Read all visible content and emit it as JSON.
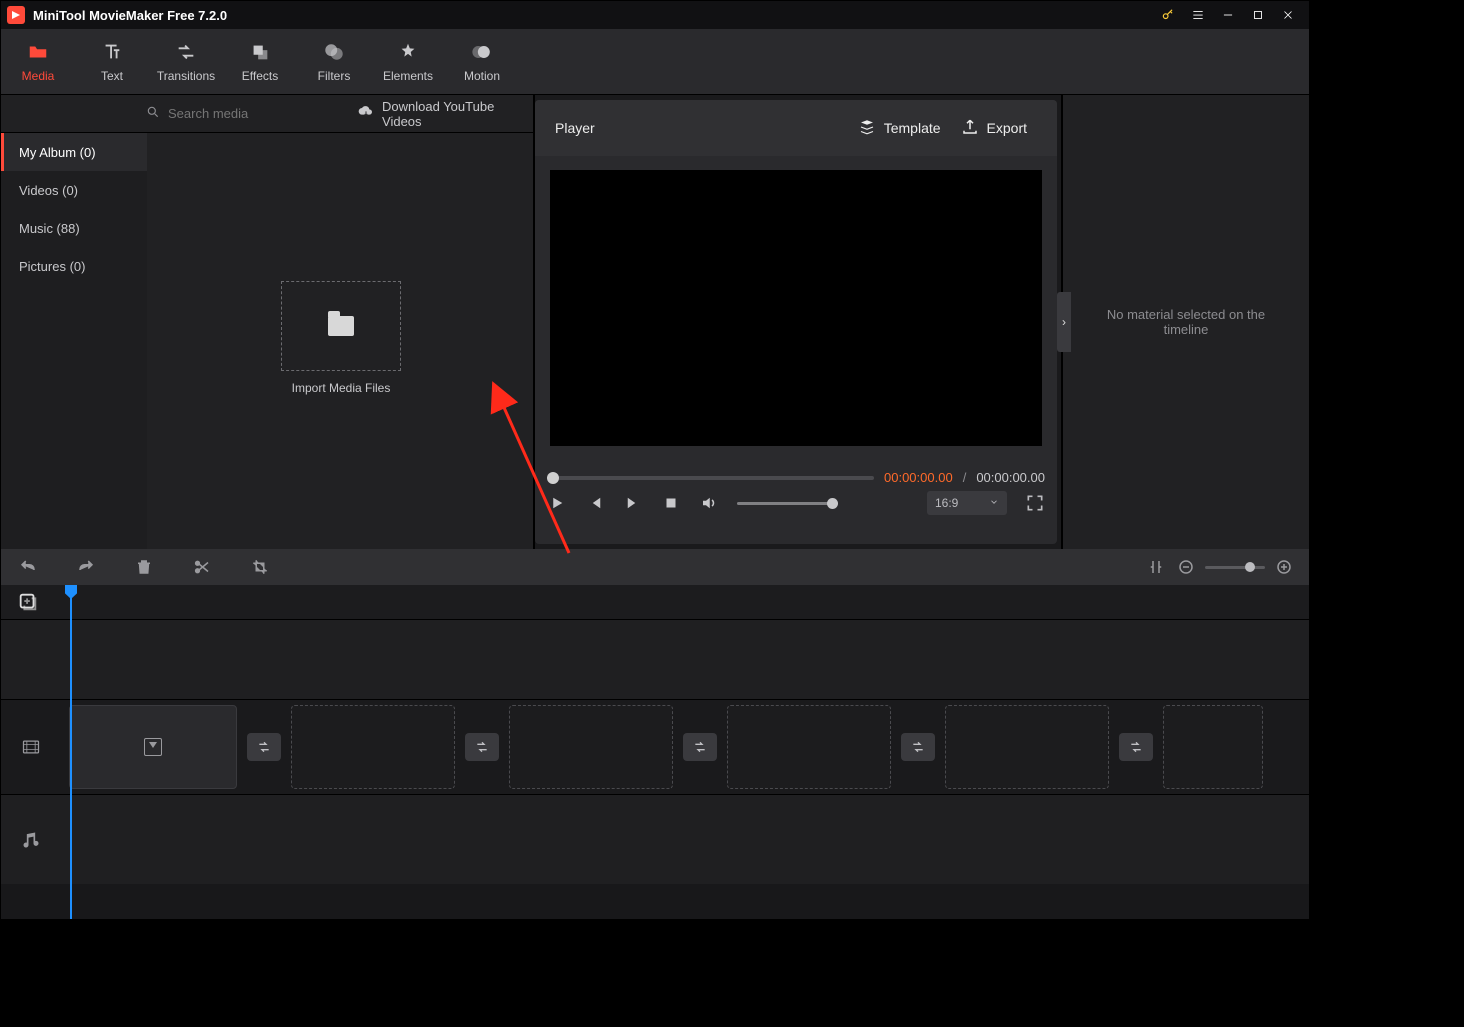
{
  "title": "MiniTool MovieMaker Free 7.2.0",
  "ribbon": [
    {
      "label": "Media",
      "active": true
    },
    {
      "label": "Text"
    },
    {
      "label": "Transitions"
    },
    {
      "label": "Effects"
    },
    {
      "label": "Filters"
    },
    {
      "label": "Elements"
    },
    {
      "label": "Motion"
    }
  ],
  "sidebar": [
    {
      "label": "My Album (0)",
      "active": true
    },
    {
      "label": "Videos (0)"
    },
    {
      "label": "Music (88)"
    },
    {
      "label": "Pictures (0)"
    }
  ],
  "search_placeholder": "Search media",
  "youtube_dl": "Download YouTube Videos",
  "import_label": "Import Media Files",
  "player": {
    "title": "Player",
    "template": "Template",
    "export": "Export",
    "tc_current": "00:00:00.00",
    "tc_sep": "/",
    "tc_total": "00:00:00.00",
    "aspect": "16:9"
  },
  "inspector_msg": "No material selected on the timeline"
}
